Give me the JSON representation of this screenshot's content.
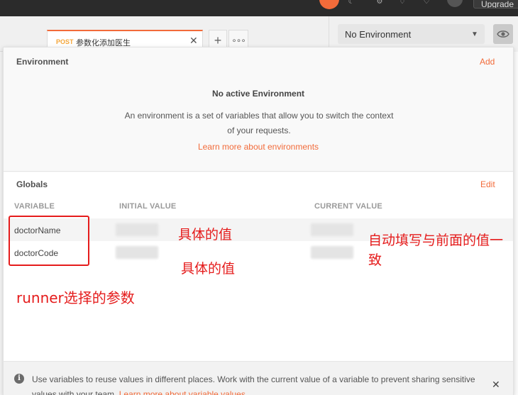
{
  "topbar": {
    "upgrade_label": "Upgrade",
    "icons": [
      "sync-icon",
      "satellite-icon",
      "settings-icon",
      "notifications-icon",
      "heart-icon",
      "avatar-icon"
    ]
  },
  "tab": {
    "method": "POST",
    "title": "参数化添加医生",
    "close_symbol": "✕"
  },
  "tab_actions": {
    "add_symbol": "+",
    "more_symbol": "∘∘∘"
  },
  "environment_selector": {
    "selected": "No Environment",
    "caret_symbol": "▼"
  },
  "environment": {
    "title": "Environment",
    "add_label": "Add",
    "empty_title": "No active Environment",
    "empty_description": "An environment is a set of variables that allow you to switch the context of your requests.",
    "learn_link": "Learn more about environments"
  },
  "globals": {
    "title": "Globals",
    "edit_label": "Edit",
    "columns": [
      "VARIABLE",
      "INITIAL VALUE",
      "CURRENT VALUE"
    ],
    "rows": [
      {
        "variable": "doctorName"
      },
      {
        "variable": "doctorCode"
      }
    ]
  },
  "footer": {
    "text": "Use variables to reuse values in different places. Work with the current value of a variable to prevent sharing sensitive values with your team.",
    "link": "Learn more about variable values",
    "close_symbol": "✕"
  },
  "annotations": {
    "value_note_1": "具体的值",
    "value_note_2": "具体的值",
    "current_note": "自动填写与前面的值一致",
    "runner_note": "runner选择的参数"
  },
  "colors": {
    "accent": "#f26b3a",
    "annotation_red": "#e51c1c",
    "topbar": "#2b2b2b"
  }
}
